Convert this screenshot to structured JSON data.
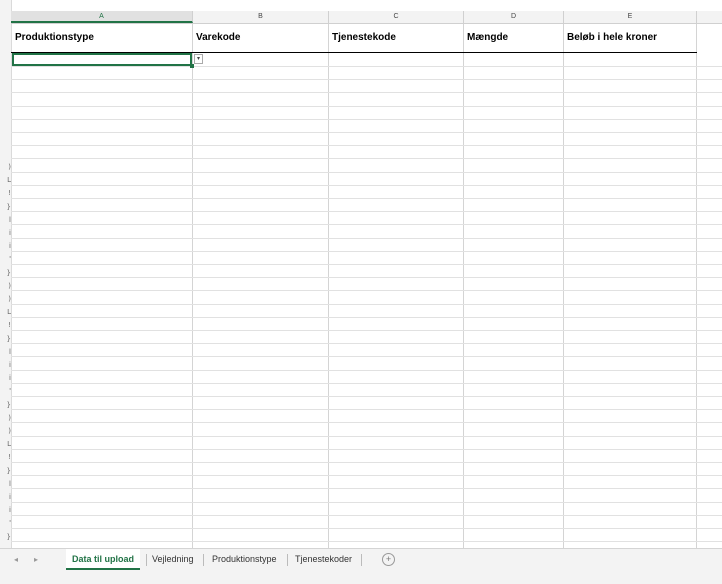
{
  "columns": [
    {
      "letter": "A",
      "header": "Produktionstype"
    },
    {
      "letter": "B",
      "header": "Varekode"
    },
    {
      "letter": "C",
      "header": "Tjenestekode"
    },
    {
      "letter": "D",
      "header": "Mængde"
    },
    {
      "letter": "E",
      "header": "Beløb i hele kroner"
    }
  ],
  "row_number_fragments": [
    ")",
    "L",
    "!",
    "}",
    "l",
    "i",
    "i",
    "'",
    "}",
    ")",
    ")",
    "L",
    "!",
    "}",
    "l",
    "i",
    "i",
    "'",
    "}",
    ")",
    ")",
    "L",
    "!",
    "}",
    "l",
    "i",
    "i",
    "'",
    "}"
  ],
  "tabs": [
    {
      "label": "Data til upload",
      "active": true
    },
    {
      "label": "Vejledning",
      "active": false
    },
    {
      "label": "Produktionstype",
      "active": false
    },
    {
      "label": "Tjenestekoder",
      "active": false
    }
  ],
  "nav": {
    "prev": "◂",
    "next": "▸"
  },
  "add_sheet_symbol": "+",
  "dropdown_symbol": "▾",
  "colors": {
    "accent": "#217346",
    "gridline": "#e1e1e1",
    "header_bg": "#f3f3f3"
  }
}
